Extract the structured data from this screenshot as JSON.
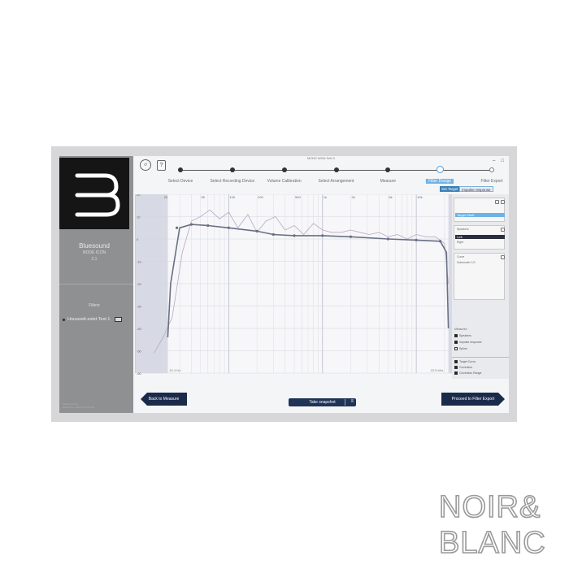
{
  "window": {
    "title": "MODE MSM Sett 0"
  },
  "window_controls": [
    "–",
    "□"
  ],
  "toolbar": {
    "undo_icon": "undo-circle-icon",
    "help_label": "?"
  },
  "brand": {
    "name": "Bluesound",
    "model": "NODE ICON",
    "version": "2.1"
  },
  "filters": {
    "heading": "Filters",
    "items": [
      {
        "label": "Housewit-estet Test 1",
        "badge": "1"
      }
    ]
  },
  "sidebar_footer": [
    "Measurement:",
    "Date/Time: 2023-01-01 00:00"
  ],
  "stepper": {
    "steps": [
      {
        "label": "Select Device",
        "state": "done"
      },
      {
        "label": "Select Recording Device",
        "state": "done"
      },
      {
        "label": "Volume Calibration",
        "state": "done"
      },
      {
        "label": "Select Arrangement",
        "state": "done"
      },
      {
        "label": "Measure",
        "state": "done"
      },
      {
        "label": "Filter Design",
        "state": "active"
      },
      {
        "label": "Filter Export",
        "state": "future"
      }
    ],
    "sub_tabs": [
      "Set Target",
      "Impulse response"
    ]
  },
  "chart_data": {
    "type": "line",
    "x_scale": "log",
    "xlim": [
      10,
      24000
    ],
    "ylim": [
      -60,
      20
    ],
    "x_ticks": [
      "20",
      "50",
      "100",
      "200",
      "500",
      "1k",
      "2k",
      "5k",
      "10k"
    ],
    "y_ticks": [
      "20",
      "10",
      "0",
      "-10",
      "-20",
      "-30",
      "-40",
      "-50",
      "-60"
    ],
    "range_labels": {
      "low": "22.4 Hz",
      "high": "22.0 kHz"
    },
    "grid": true,
    "series": [
      {
        "name": "Measured",
        "color": "#b8a8c6",
        "x": [
          16,
          20,
          25,
          32,
          40,
          50,
          63,
          80,
          100,
          125,
          160,
          200,
          250,
          315,
          400,
          500,
          630,
          800,
          1000,
          1250,
          1600,
          2000,
          2500,
          3150,
          4000,
          5000,
          6300,
          8000,
          10000,
          12500,
          16000,
          20000,
          22000
        ],
        "y": [
          -51,
          -44,
          -35,
          -6,
          8,
          10,
          13,
          9,
          12,
          5,
          11,
          3,
          8,
          10,
          4,
          6,
          2,
          7,
          4,
          3,
          3,
          4,
          3,
          2,
          3,
          1,
          2,
          0,
          2,
          1,
          1,
          -2,
          -20
        ]
      },
      {
        "name": "Target",
        "color": "#6a6f84",
        "x": [
          22.4,
          24,
          30,
          40,
          60,
          100,
          200,
          300,
          500,
          1000,
          2000,
          5000,
          10000,
          18000,
          21000,
          22000
        ],
        "y": [
          -44,
          -20,
          5,
          6.5,
          6,
          5,
          3.5,
          2,
          1.5,
          1.5,
          1,
          0,
          -0.5,
          -1,
          -6,
          -40
        ]
      }
    ],
    "target_nodes_x": [
      28,
      40,
      60,
      100,
      200,
      300,
      500,
      1000,
      2000,
      5000,
      10000,
      18000
    ],
    "target_nodes_y": [
      5,
      6.5,
      6,
      5,
      3.5,
      2,
      1.5,
      1.5,
      1,
      0,
      -0.5,
      -1
    ]
  },
  "right_panel": {
    "target_box": {
      "selected": "Target Shelf"
    },
    "speaker_box": {
      "label": "Speakers",
      "options": [
        "Left",
        "Right"
      ],
      "selected": "Left"
    },
    "curve_box": {
      "label": "Curve",
      "value": "Subwoofer 1/2"
    },
    "section_label": "Measures",
    "checks_top": [
      {
        "label": "Speakers",
        "on": true
      },
      {
        "label": "Impulse response",
        "on": true
      },
      {
        "label": "Spline",
        "on": false
      }
    ],
    "checks_bottom": [
      {
        "label": "Target Curve",
        "on": true
      },
      {
        "label": "Correction",
        "on": true
      },
      {
        "label": "Correction Range",
        "on": true
      }
    ]
  },
  "bottom": {
    "back_label": "Back to Measure",
    "snapshot_label": "Take snapshot",
    "next_label": "Proceed to Filter Export"
  },
  "watermark": {
    "line1": "NOIR&",
    "line2": "BLANC"
  }
}
